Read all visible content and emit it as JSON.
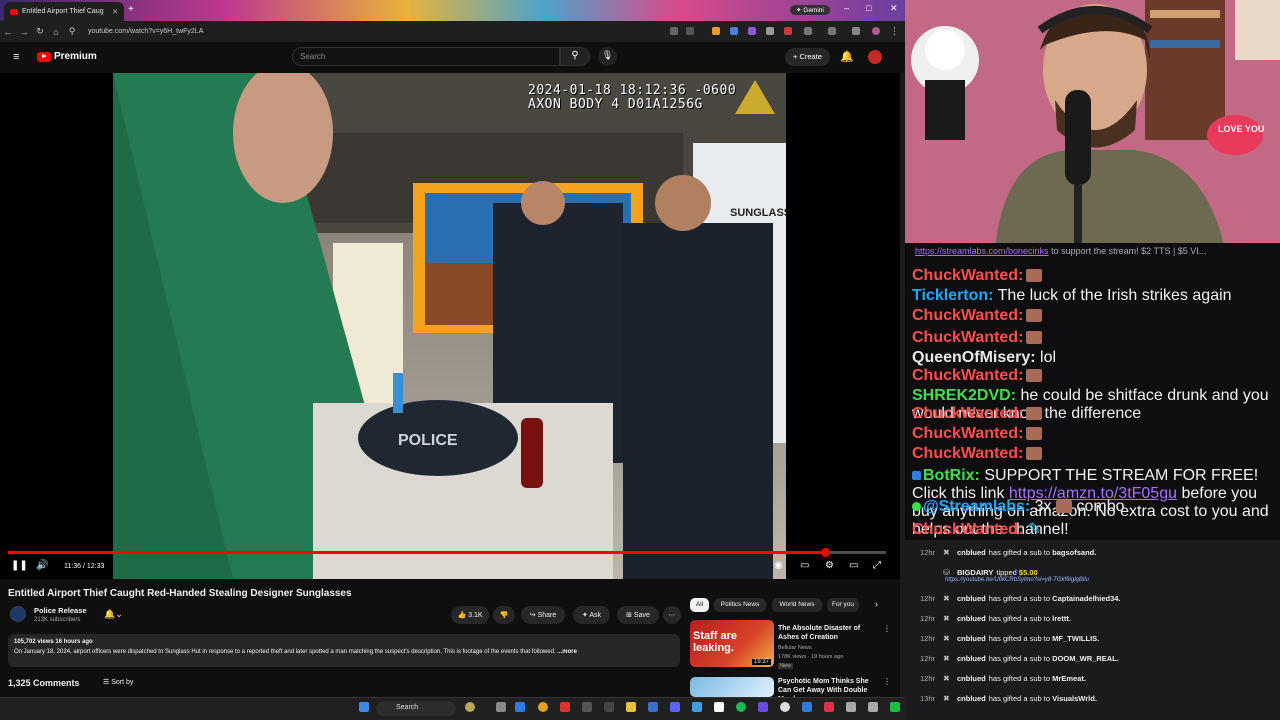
{
  "browser": {
    "tab_title": "Entitled Airport Thief Caug",
    "gemini_label": "Gemini",
    "url": "youtube.com/watch?v=y6H_twFy2LA"
  },
  "youtube": {
    "premium_label": "Premium",
    "search_placeholder": "Search",
    "create_label": "Create",
    "video": {
      "osd_line1": "2024-01-18 18:12:36 -0600",
      "osd_line2": "AXON BODY 4 D01A1256G",
      "police_text": "POLICE",
      "sunglass_sign": "SUNGLASS",
      "time": "11:36 / 12:33",
      "progress": 0.93
    },
    "title": "Entitled Airport Thief Caught Red-Handed Stealing Designer Sunglasses",
    "channel": "Police Release",
    "subscribers": "213K subscribers",
    "likes": "3.1K",
    "share_label": "Share",
    "ask_label": "Ask",
    "save_label": "Save",
    "desc_meta": "105,702 views  16 hours ago",
    "desc_text": "On January 18, 2024, airport officers were dispatched to Sunglass Hut in response to a reported theft and later spotted a man matching the suspect's description. This is footage of the events that followed.",
    "desc_more": "...more",
    "comments_count": "1,325 Comments",
    "sort_label": "Sort by",
    "chips": [
      "All",
      "Politics News",
      "World News",
      "For you"
    ],
    "recs": [
      {
        "title": "The Absolute Disaster of Ashes of Creation",
        "channel": "Bellular News",
        "meta": "178K views · 19 hours ago",
        "badge": "New",
        "duration": "19:37",
        "thumb_text": "Staff are leaking."
      },
      {
        "title": "Psychotic Mom Thinks She Can Get Away With Double Murder",
        "channel": "",
        "meta": "",
        "badge": "",
        "duration": "",
        "thumb_text": ""
      }
    ]
  },
  "taskbar": {
    "search_label": "Search"
  },
  "stream": {
    "love_sign": "LOVE YOU",
    "top_line_link": "https://streamlabs.com/bonecinks",
    "top_line_text": " to support the stream! $2 TTS | $5 VI...",
    "chat": [
      {
        "user": "ChuckWanted:",
        "text": "",
        "color": "#ff4d4d",
        "emote": true
      },
      {
        "user": "Ticklerton:",
        "text": "The luck of the Irish strikes again",
        "color": "#1ea7ff",
        "emote": false
      },
      {
        "user": "ChuckWanted:",
        "text": "",
        "color": "#ff4d4d",
        "emote": true
      },
      {
        "user": "ChuckWanted:",
        "text": "",
        "color": "#ff4d4d",
        "emote": true
      },
      {
        "user": "QueenOfMisery:",
        "text": "lol",
        "color": "#e8e8e8",
        "emote": false
      },
      {
        "user": "ChuckWanted:",
        "text": "",
        "color": "#ff4d4d",
        "emote": true
      },
      {
        "user": "SHREK2DVD:",
        "text": "he could be shitface drunk and you would never know the difference",
        "color": "#3ee04a",
        "emote": false
      },
      {
        "user": "ChuckWanted:",
        "text": "",
        "color": "#ff4d4d",
        "emote": true
      },
      {
        "user": "ChuckWanted:",
        "text": "",
        "color": "#ff4d4d",
        "emote": true
      },
      {
        "user": "ChuckWanted:",
        "text": "",
        "color": "#ff4d4d",
        "emote": true
      }
    ],
    "botrix_user": "BotRix:",
    "botrix_text": "SUPPORT THE STREAM FOR FREE! Click this link ",
    "botrix_link": "https://amzn.to/3tF05gu",
    "botrix_text2": "before you buy anything on amazon. No extra cost to you and helps out the channel!",
    "streamlabs_user": "@Streamlabs:",
    "streamlabs_text": "3x",
    "streamlabs_combo": "combo",
    "last_user": "ChuckWanted:",
    "events": [
      {
        "t": "12hr",
        "user": "cnblued",
        "text": "has gifted a sub to",
        "target": "bagsofsand."
      },
      {
        "t": "12hr",
        "user": "BIGDAIRY",
        "text": "tipped",
        "target": "$5.00",
        "sub": "https://youtube.be/U0kCRbSylmo?si=y8-TGkf6iglqBilu"
      },
      {
        "t": "12hr",
        "user": "cnblued",
        "text": "has gifted a sub to",
        "target": "Captainadelhied34."
      },
      {
        "t": "12hr",
        "user": "cnblued",
        "text": "has gifted a sub to",
        "target": "lrettt."
      },
      {
        "t": "12hr",
        "user": "cnblued",
        "text": "has gifted a sub to",
        "target": "MF_TWILLIS."
      },
      {
        "t": "12hr",
        "user": "cnblued",
        "text": "has gifted a sub to",
        "target": "DOOM_WR_REAL."
      },
      {
        "t": "12hr",
        "user": "cnblued",
        "text": "has gifted a sub to",
        "target": "MrEmeat."
      },
      {
        "t": "13hr",
        "user": "cnblued",
        "text": "has gifted a sub to",
        "target": "VisualsWrld."
      }
    ]
  }
}
